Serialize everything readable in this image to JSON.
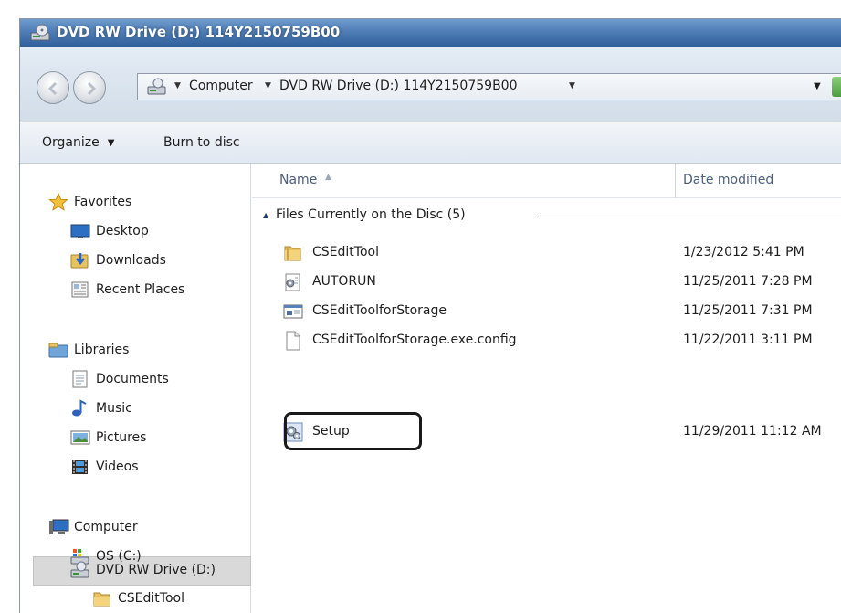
{
  "window": {
    "title": "DVD RW Drive (D:) 114Y2150759B00"
  },
  "address_bar": {
    "crumbs": [
      "Computer",
      "DVD RW Drive (D:) 114Y2150759B00"
    ]
  },
  "toolbar": {
    "organize_label": "Organize",
    "burn_label": "Burn to disc"
  },
  "navigation": {
    "favorites": {
      "label": "Favorites",
      "items": [
        "Desktop",
        "Downloads",
        "Recent Places"
      ]
    },
    "libraries": {
      "label": "Libraries",
      "items": [
        "Documents",
        "Music",
        "Pictures",
        "Videos"
      ]
    },
    "computer": {
      "label": "Computer",
      "items": [
        "OS (C:)",
        "DVD RW Drive (D:)",
        "CSEditTool"
      ],
      "selected": "DVD RW Drive (D:)"
    }
  },
  "file_list": {
    "columns": {
      "name": "Name",
      "date": "Date modified"
    },
    "group_title": "Files Currently on the Disc (5)",
    "files": [
      {
        "name": "CSEditTool",
        "date": "1/23/2012 5:41 PM",
        "icon": "folder-icon"
      },
      {
        "name": "AUTORUN",
        "date": "11/25/2011 7:28 PM",
        "icon": "settings-file-icon"
      },
      {
        "name": "CSEditToolforStorage",
        "date": "11/25/2011 7:31 PM",
        "icon": "application-icon"
      },
      {
        "name": "CSEditToolforStorage.exe.config",
        "date": "11/22/2011 3:11 PM",
        "icon": "blank-file-icon"
      },
      {
        "name": "Setup",
        "date": "11/29/2011 11:12 AM",
        "icon": "setup-icon"
      }
    ],
    "highlighted_file": "Setup"
  },
  "colors": {
    "titlebar": "#4f7db5",
    "selected_nav": "#d9d9d9",
    "callout_border": "#1a1a1a"
  }
}
